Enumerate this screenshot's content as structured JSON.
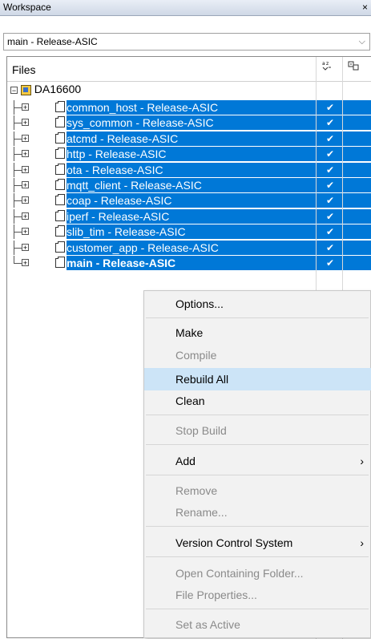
{
  "window": {
    "title": "Workspace",
    "close": "×"
  },
  "config": {
    "selected": "main - Release-ASIC",
    "arrow": "⌵"
  },
  "files_header": {
    "title": "Files",
    "col1_icon": "sort-icon",
    "col2_icon": "build-icon"
  },
  "tree": {
    "root": "DA16600",
    "items": [
      {
        "label": "common_host - Release-ASIC",
        "checked": "✔",
        "bold": false
      },
      {
        "label": "sys_common - Release-ASIC",
        "checked": "✔",
        "bold": false
      },
      {
        "label": "atcmd - Release-ASIC",
        "checked": "✔",
        "bold": false
      },
      {
        "label": "http - Release-ASIC",
        "checked": "✔",
        "bold": false
      },
      {
        "label": "ota - Release-ASIC",
        "checked": "✔",
        "bold": false
      },
      {
        "label": "mqtt_client - Release-ASIC",
        "checked": "✔",
        "bold": false
      },
      {
        "label": "coap - Release-ASIC",
        "checked": "✔",
        "bold": false
      },
      {
        "label": "iperf - Release-ASIC",
        "checked": "✔",
        "bold": false
      },
      {
        "label": "slib_tim - Release-ASIC",
        "checked": "✔",
        "bold": false
      },
      {
        "label": "customer_app - Release-ASIC",
        "checked": "✔",
        "bold": false
      },
      {
        "label": "main - Release-ASIC",
        "checked": "✔",
        "bold": true
      }
    ]
  },
  "context_menu": {
    "options": "Options...",
    "make": "Make",
    "compile": "Compile",
    "rebuild_all": "Rebuild All",
    "clean": "Clean",
    "stop_build": "Stop Build",
    "add": "Add",
    "remove": "Remove",
    "rename": "Rename...",
    "vcs": "Version Control System",
    "open_folder": "Open Containing Folder...",
    "file_properties": "File Properties...",
    "set_active": "Set as Active",
    "submenu_arrow": "›"
  },
  "colors": {
    "selection": "#0078d7",
    "menu_highlight": "#cce4f7",
    "menu_bg": "#f2f2f2"
  }
}
